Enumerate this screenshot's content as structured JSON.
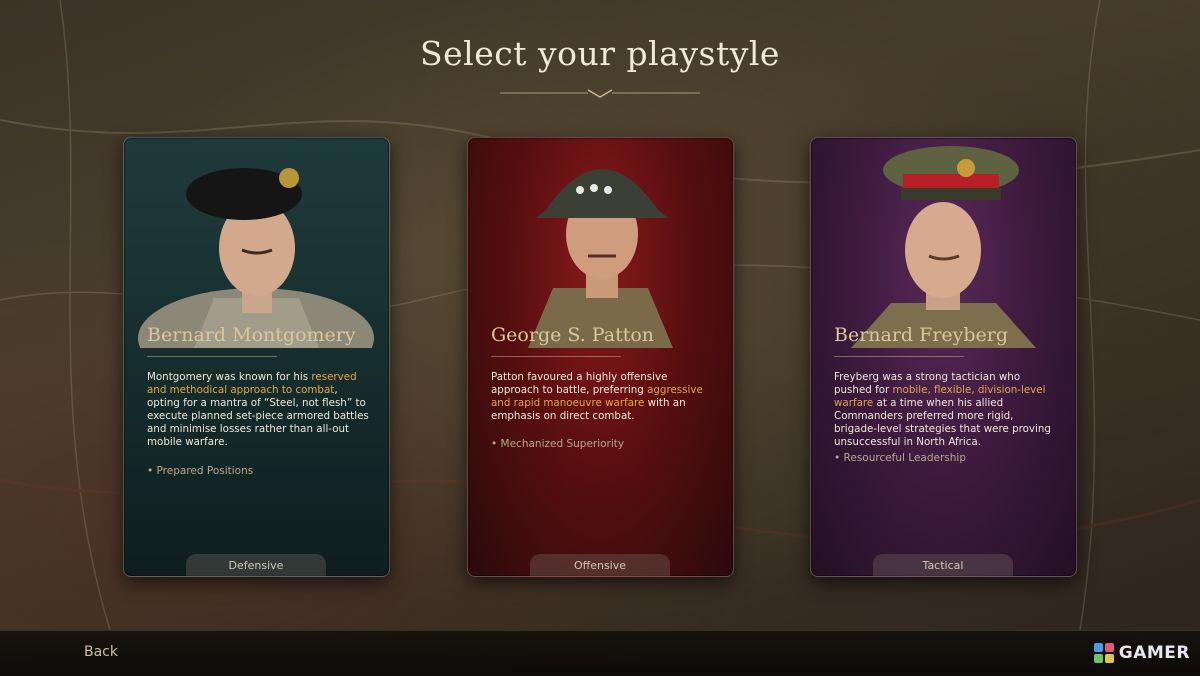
{
  "title": "Select your playstyle",
  "cards": [
    {
      "name": "Bernard Montgomery",
      "desc": [
        {
          "t": "Montgomery was known for his ",
          "hl": false
        },
        {
          "t": "reserved and methodical approach to combat",
          "hl": true
        },
        {
          "t": ", opting for a mantra of  “Steel, not flesh” to execute planned set-piece armored battles and minimise losses rather than all-out mobile warfare.",
          "hl": false
        }
      ],
      "trait": "• Prepared Positions",
      "playstyle": "Defensive",
      "portrait": "montgomery-portrait"
    },
    {
      "name": "George S. Patton",
      "desc": [
        {
          "t": "Patton favoured a highly offensive approach to battle, preferring ",
          "hl": false
        },
        {
          "t": "aggressive and rapid manoeuvre warfare",
          "hl": true
        },
        {
          "t": " with an emphasis on direct combat.",
          "hl": false
        }
      ],
      "trait": "• Mechanized Superiority",
      "playstyle": "Offensive",
      "portrait": "patton-portrait"
    },
    {
      "name": "Bernard Freyberg",
      "desc": [
        {
          "t": "Freyberg was a strong tactician who pushed for ",
          "hl": false
        },
        {
          "t": "mobile, flexible, division-level warfare",
          "hl": true
        },
        {
          "t": " at a time when his allied Commanders preferred more rigid, brigade-level strategies that were proving unsuccessful in North Africa.",
          "hl": false
        }
      ],
      "trait": "• Resourceful Leadership",
      "playstyle": "Tactical",
      "portrait": "freyberg-portrait"
    }
  ],
  "bottom": {
    "back_label": "Back",
    "watermark": "GAMER"
  },
  "colors": {
    "highlight": "#e0a64d",
    "name": "#d9c89b",
    "card1": "#1f3a3b",
    "card2": "#8a1a1a",
    "card3": "#5a2a58"
  }
}
